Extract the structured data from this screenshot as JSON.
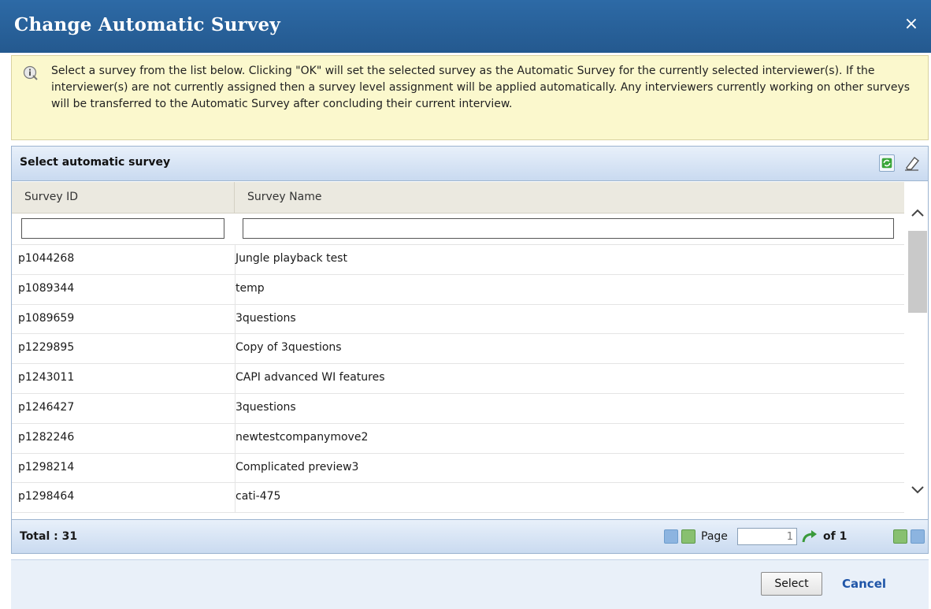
{
  "dialog": {
    "title": "Change Automatic Survey",
    "close_symbol": "×"
  },
  "info": {
    "icon": "info-icon",
    "text": "Select a survey from the list below. Clicking \"OK\" will set the selected survey as the Automatic Survey for the currently selected interviewer(s). If the interviewer(s) are not currently assigned then a survey level assignment will be applied automatically. Any interviewers currently working on other surveys will be transferred to the Automatic Survey after concluding their current interview."
  },
  "grid": {
    "title": "Select automatic survey",
    "columns": [
      "Survey ID",
      "Survey Name"
    ],
    "filters": [
      "",
      ""
    ],
    "rows": [
      {
        "id": "p1044268",
        "name": "Jungle playback test"
      },
      {
        "id": "p1089344",
        "name": "temp"
      },
      {
        "id": "p1089659",
        "name": "3questions"
      },
      {
        "id": "p1229895",
        "name": "Copy of 3questions"
      },
      {
        "id": "p1243011",
        "name": "CAPI advanced WI features"
      },
      {
        "id": "p1246427",
        "name": "3questions"
      },
      {
        "id": "p1282246",
        "name": "newtestcompanymove2"
      },
      {
        "id": "p1298214",
        "name": "Complicated preview3"
      },
      {
        "id": "p1298464",
        "name": "cati-475"
      }
    ],
    "total": "Total : 31"
  },
  "pager": {
    "page_label": "Page",
    "page_value": "1",
    "of_label": "of 1"
  },
  "actions": {
    "select_label": "Select",
    "cancel_label": "Cancel"
  },
  "colors": {
    "titlebar": "#2862a0",
    "info_bg": "#fbf8cd",
    "header_bg": "#c9daf0",
    "link": "#1f55a8"
  }
}
